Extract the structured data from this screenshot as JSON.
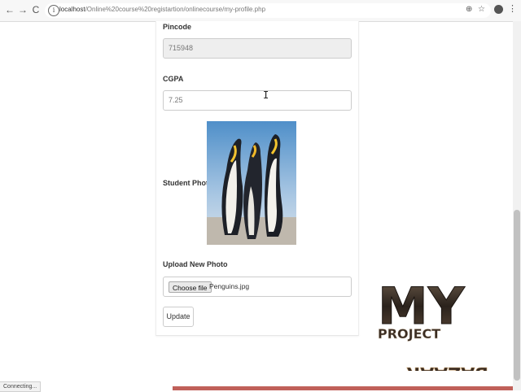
{
  "browser": {
    "back_icon": "←",
    "forward_icon": "→",
    "reload_icon": "C",
    "info_icon": "i",
    "url_host": "localhost",
    "url_path": "/Online%20course%20registartion/onlinecourse/my-profile.php",
    "zoom_icon": "⊕",
    "star_icon": "☆",
    "menu_icon": "⋮"
  },
  "form": {
    "pincode_label": "Pincode",
    "pincode_value": "715948",
    "cgpa_label": "CGPA",
    "cgpa_value": "7.25",
    "photo_label": "Student Photo",
    "upload_label": "Upload New Photo",
    "choose_file_label": "Choose file",
    "file_name": "Penguins.jpg",
    "update_label": "Update"
  },
  "cursor_glyph": "I",
  "watermark": {
    "line1": "MY",
    "line2": "PROJECT",
    "line3": "BAZAAR"
  },
  "status": {
    "text": "Connecting..."
  },
  "colors": {
    "bottom_strip": "#c0605a",
    "readonly_bg": "#eeeeee"
  }
}
